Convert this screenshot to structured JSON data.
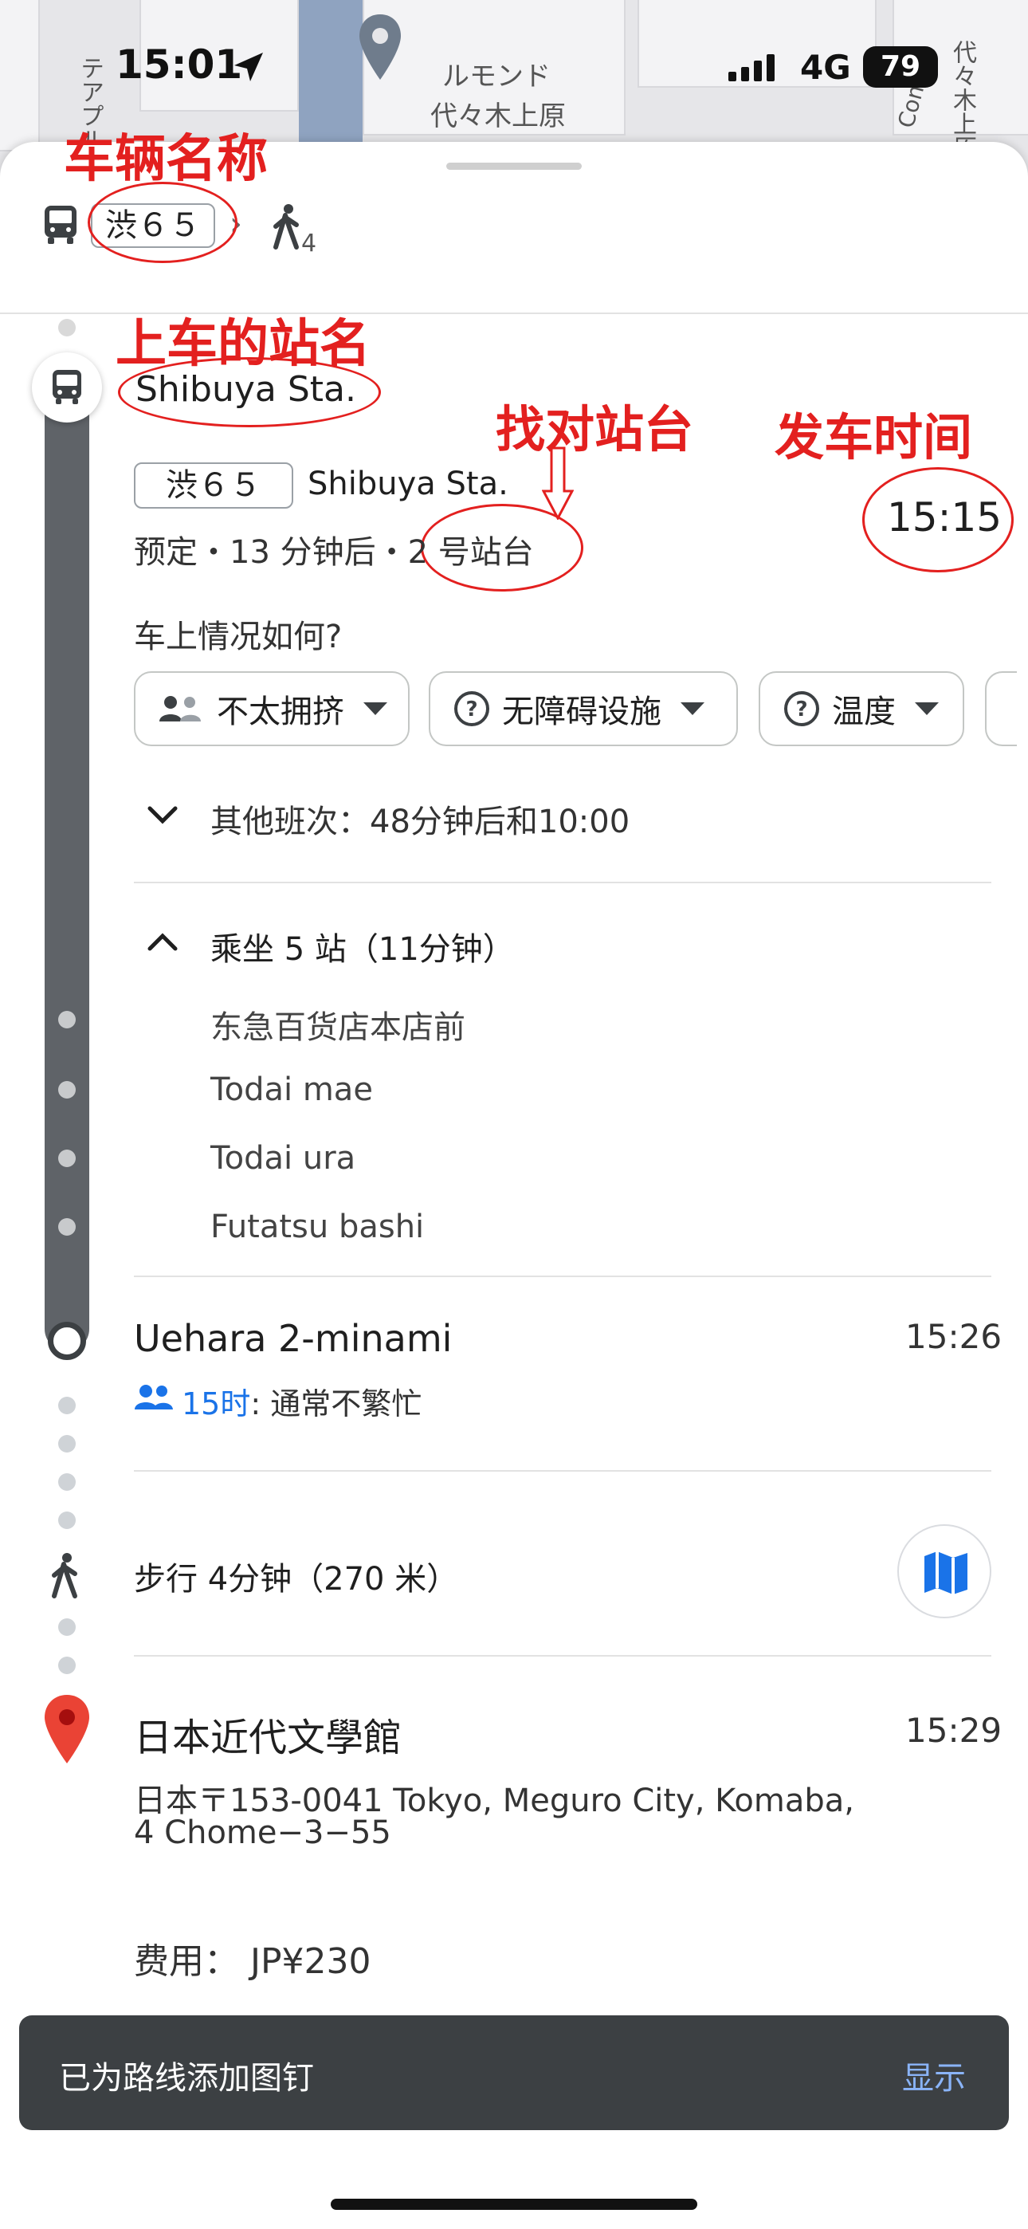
{
  "status_bar": {
    "time": "15:01",
    "network": "4G",
    "battery": "79"
  },
  "map": {
    "labels": [
      "ルモンド",
      "代々木上原",
      "テアプル",
      "Comba",
      "代々木上原"
    ]
  },
  "header": {
    "route_code": "渋６５",
    "walk_count": "4"
  },
  "annotations": {
    "vehicle_name": "车辆名称",
    "boarding_stop": "上车的站名",
    "platform": "找对站台",
    "departure_time": "发车时间"
  },
  "boarding": {
    "stop_name": "Shibuya Sta.",
    "route_chip": "渋６５",
    "route_destination": "Shibuya Sta.",
    "schedule": "预定・13 分钟后・2 号站台",
    "time": "15:15"
  },
  "feedback": {
    "question": "车上情况如何?",
    "chips": [
      "不太拥挤",
      "无障碍设施",
      "温度"
    ]
  },
  "other_trips": "其他班次：48分钟后和10:00",
  "ride": {
    "summary": "乘坐 5 站（11分钟）",
    "stops": [
      "东急百货店本店前",
      "Todai mae",
      "Todai ura",
      "Futatsu bashi"
    ]
  },
  "alight": {
    "stop_name": "Uehara 2-minami",
    "time": "15:26",
    "crowd_hour": "15时",
    "crowd_status": ": 通常不繁忙"
  },
  "walk": {
    "text": "步行 4分钟（270 米）"
  },
  "destination": {
    "name": "日本近代文學館",
    "time": "15:29",
    "address_line1": "日本〒153-0041 Tokyo, Meguro City, Komaba,",
    "address_line2": "4 Chome−3−55"
  },
  "fare": "费用：  JP¥230",
  "toast": {
    "message": "已为路线添加图钉",
    "action": "显示"
  },
  "colors": {
    "accent_blue": "#1a73e8",
    "annotation_red": "#e3201f",
    "route_gray": "#5f6368",
    "pin_red": "#ea4335"
  }
}
